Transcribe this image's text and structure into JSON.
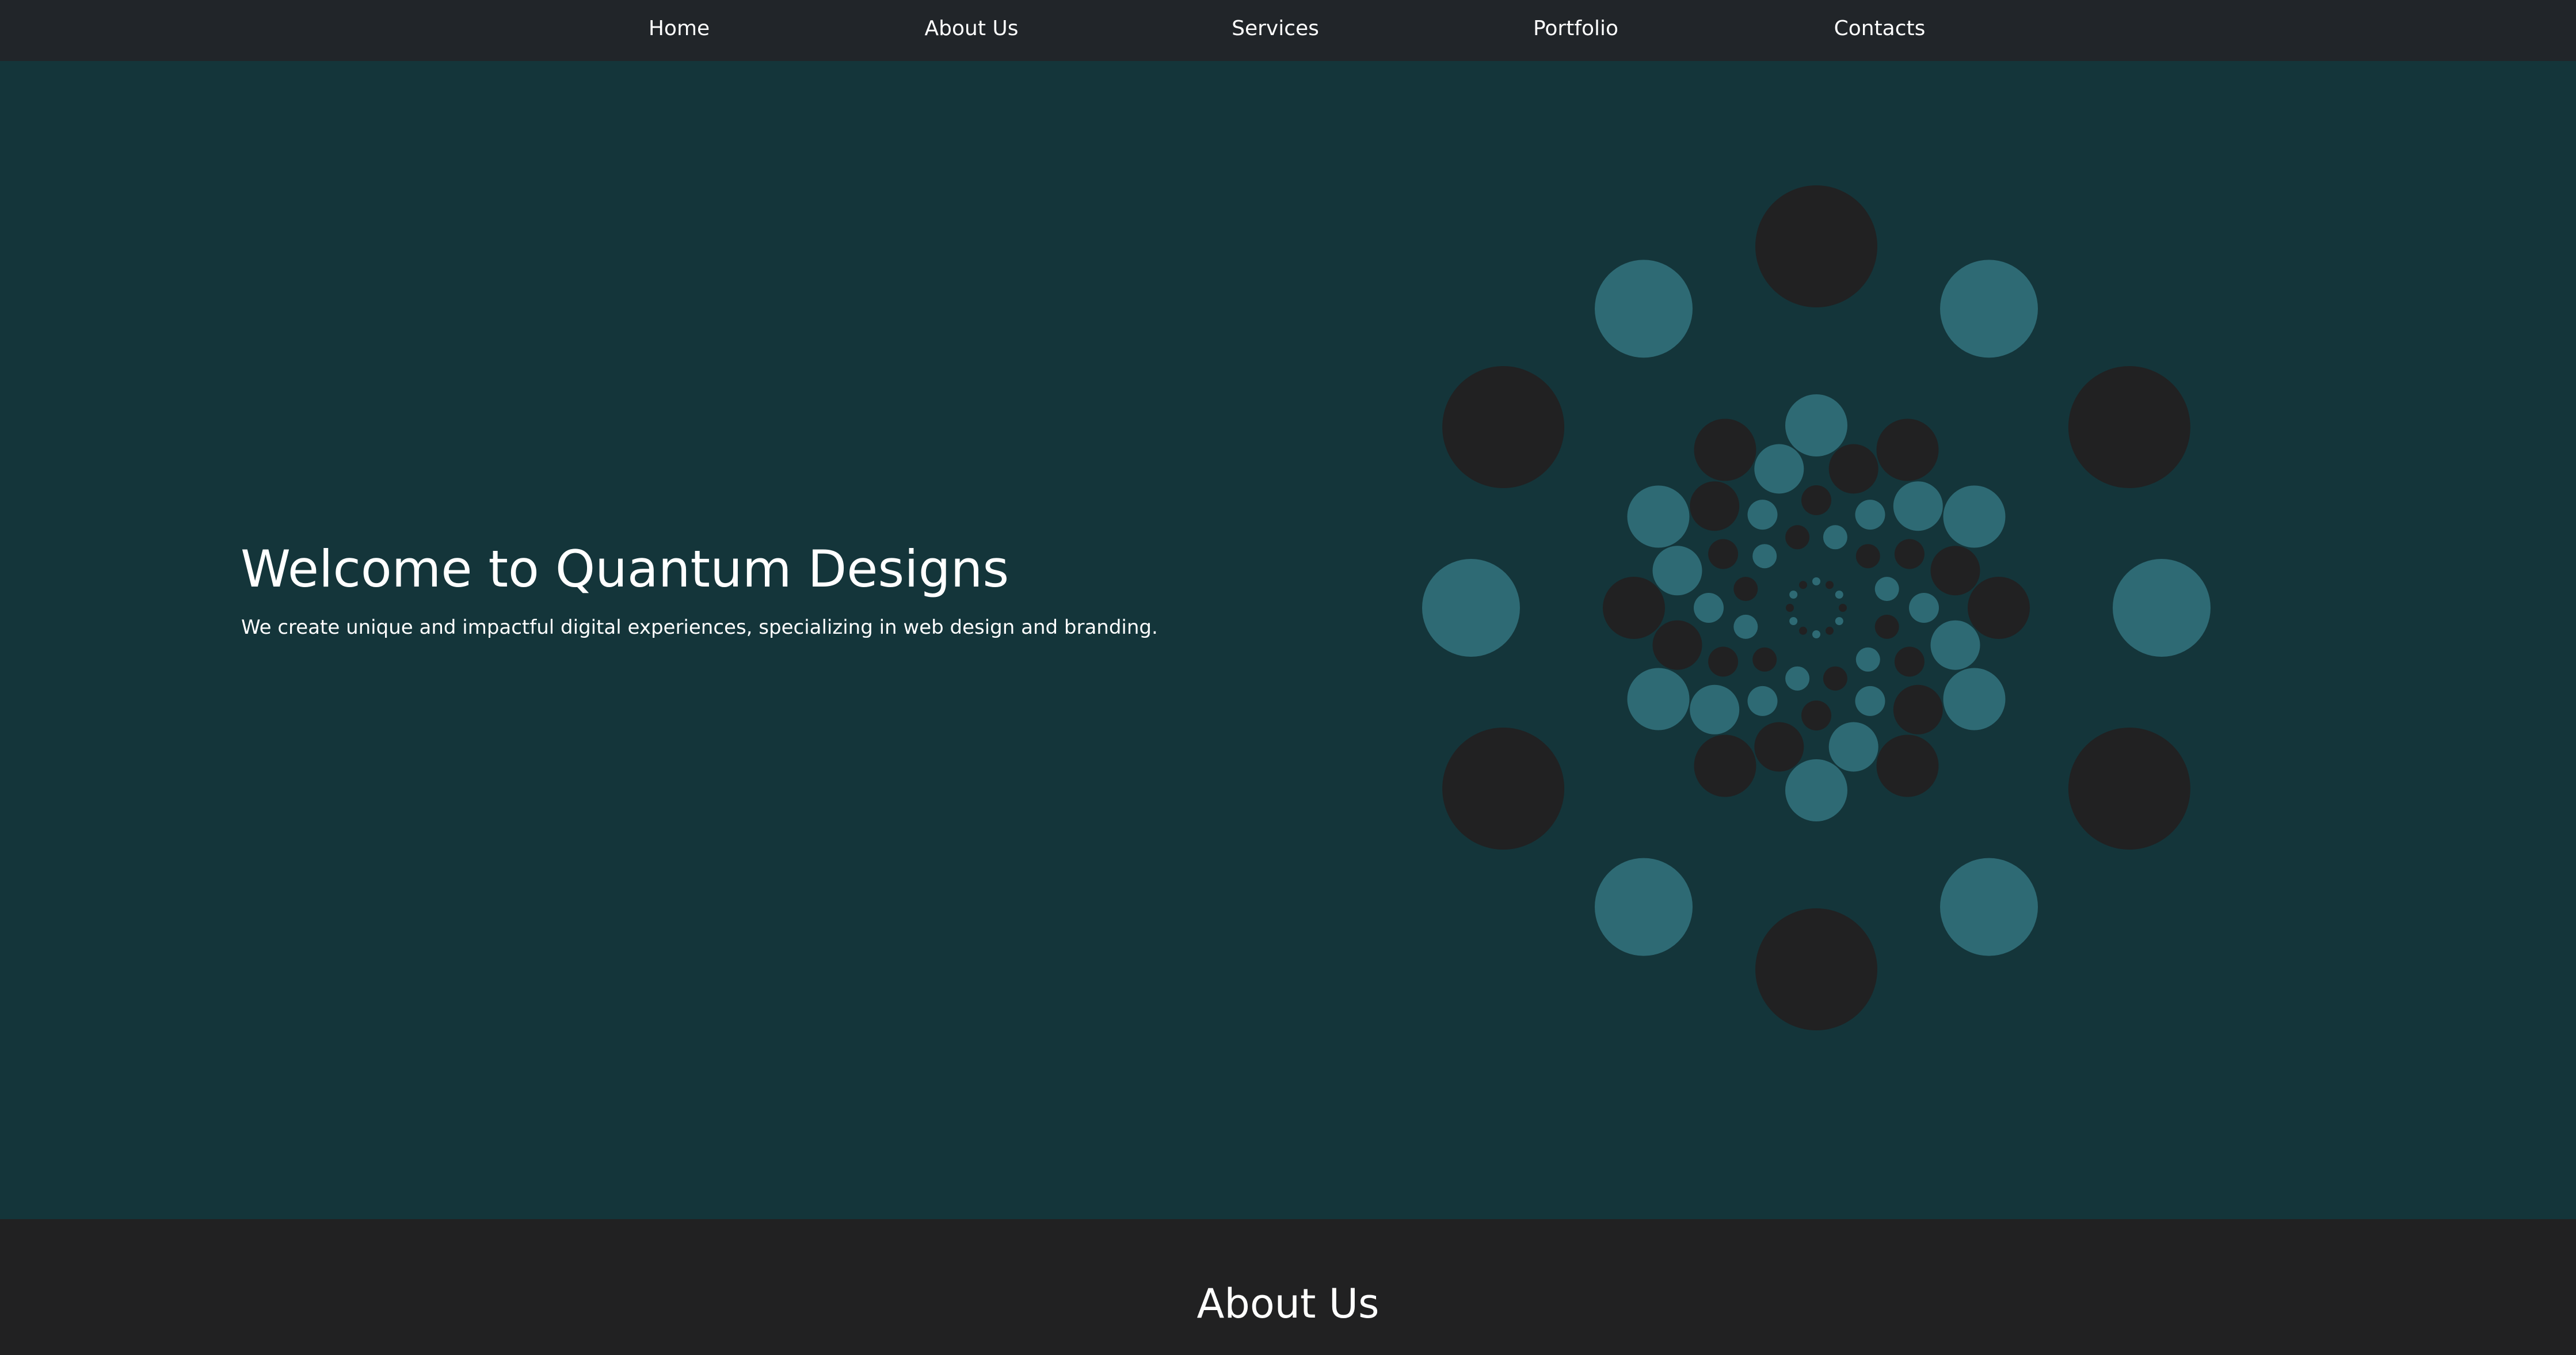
{
  "nav": {
    "items": [
      {
        "label": "Home"
      },
      {
        "label": "About Us"
      },
      {
        "label": "Services"
      },
      {
        "label": "Portfolio"
      },
      {
        "label": "Contacts"
      }
    ]
  },
  "hero": {
    "title": "Welcome to Quantum Designs",
    "subtitle": "We create unique and impactful digital experiences, specializing in web design and branding."
  },
  "about": {
    "title": "About Us"
  },
  "colors": {
    "nav_bg": "#212529",
    "hero_bg": "#14353a",
    "dark_circle": "#212122",
    "teal_circle": "#2e6a74",
    "text": "#ffffff"
  },
  "icons": {
    "hero_graphic": "concentric-dot-pattern-icon"
  }
}
